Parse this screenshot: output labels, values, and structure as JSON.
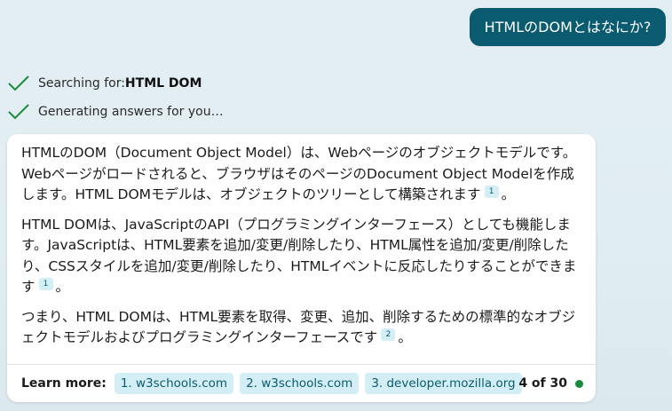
{
  "user_message": "HTMLのDOMとはなにか?",
  "status": {
    "searching_prefix": "Searching for: ",
    "searching_query": "HTML DOM",
    "generating": "Generating answers for you…"
  },
  "answer": {
    "p1_text": "HTMLのDOM（Document Object Model）は、Webページのオブジェクトモデルです。Webページがロードされると、ブラウザはそのページのDocument Object Modelを作成します。HTML DOMモデルは、オブジェクトのツリーとして構築されます",
    "p1_cite": "1",
    "p1_end": "。",
    "p2_text": "HTML DOMは、JavaScriptのAPI（プログラミングインターフェース）としても機能します。JavaScriptは、HTML要素を追加/変更/削除したり、HTML属性を追加/変更/削除したり、CSSスタイルを追加/変更/削除したり、HTMLイベントに反応したりすることができます",
    "p2_cite": "1",
    "p2_end": "。",
    "p3_text": "つまり、HTML DOMは、HTML要素を取得、変更、追加、削除するための標準的なオブジェクトモデルおよびプログラミングインターフェースです",
    "p3_cite": "2",
    "p3_end": "。"
  },
  "learn_more": {
    "label": "Learn more:",
    "links": [
      "1. w3schools.com",
      "2. w3schools.com",
      "3. developer.mozilla.org"
    ],
    "count": "4 of 30"
  },
  "colors": {
    "accent": "#0a5b70",
    "chip_bg": "#d4eef5",
    "check": "#1c8a3d",
    "status_dot": "#1c8a3d"
  },
  "icons": {
    "status": "check-icon"
  }
}
